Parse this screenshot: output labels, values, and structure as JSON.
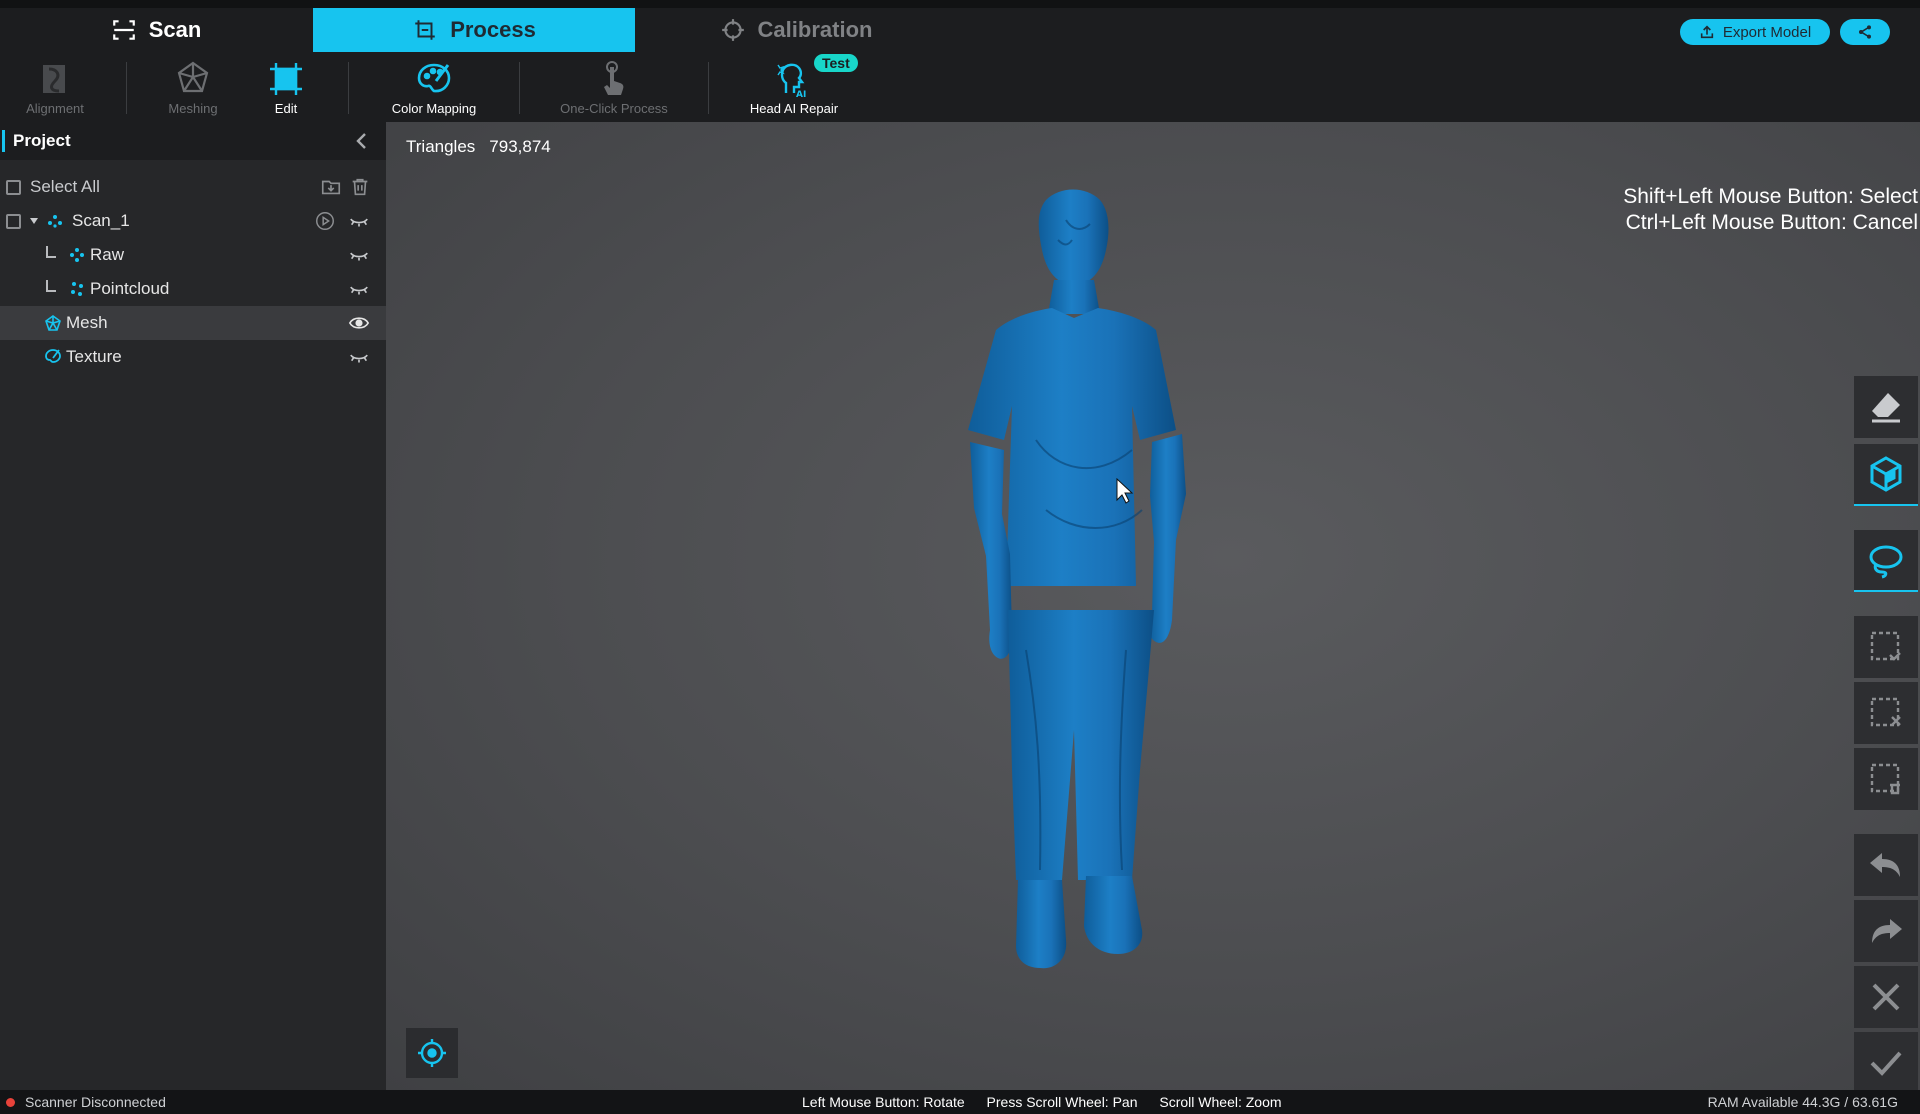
{
  "modes": {
    "scan": "Scan",
    "process": "Process",
    "calibration": "Calibration"
  },
  "header": {
    "export_label": "Export Model"
  },
  "toolbar": {
    "alignment": "Alignment",
    "meshing": "Meshing",
    "edit": "Edit",
    "color_mapping": "Color Mapping",
    "one_click": "One-Click Process",
    "head_ai_repair": "Head AI Repair",
    "test_badge": "Test"
  },
  "project": {
    "title": "Project",
    "select_all": "Select All",
    "tree": {
      "scan": "Scan_1",
      "raw": "Raw",
      "pointcloud": "Pointcloud",
      "mesh": "Mesh",
      "texture": "Texture"
    }
  },
  "viewport": {
    "triangles_label": "Triangles",
    "triangles_value": "793,874",
    "hint_select": "Shift+Left Mouse Button: Select",
    "hint_cancel": "Ctrl+Left Mouse Button: Cancel"
  },
  "status": {
    "scanner": "Scanner Disconnected",
    "rotate": "Left Mouse Button: Rotate",
    "pan": "Press Scroll Wheel: Pan",
    "zoom": "Scroll Wheel: Zoom",
    "ram": "RAM Available 44.3G / 63.61G"
  },
  "colors": {
    "accent": "#17c4ef",
    "model_blue": "#1a72b8",
    "status_error": "#e8423a"
  }
}
